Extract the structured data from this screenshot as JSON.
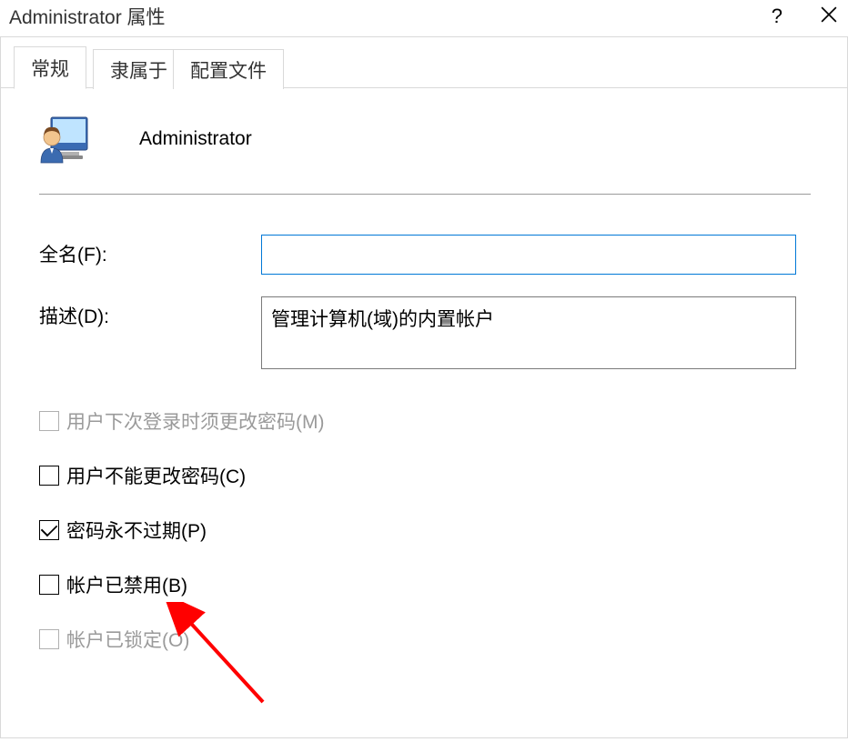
{
  "window": {
    "title": "Administrator 属性"
  },
  "tabs": {
    "general": "常规",
    "memberof": "隶属于",
    "profile": "配置文件"
  },
  "user": {
    "display_name": "Administrator"
  },
  "fields": {
    "fullname_label": "全名(F):",
    "fullname_value": "",
    "description_label": "描述(D):",
    "description_value": "管理计算机(域)的内置帐户"
  },
  "checkboxes": {
    "must_change": {
      "label": "用户下次登录时须更改密码(M)",
      "checked": false,
      "disabled": true
    },
    "cannot_change": {
      "label": "用户不能更改密码(C)",
      "checked": false,
      "disabled": false
    },
    "never_expires": {
      "label": "密码永不过期(P)",
      "checked": true,
      "disabled": false
    },
    "account_disabled": {
      "label": "帐户已禁用(B)",
      "checked": false,
      "disabled": false
    },
    "account_locked": {
      "label": "帐户已锁定(O)",
      "checked": false,
      "disabled": true
    }
  }
}
